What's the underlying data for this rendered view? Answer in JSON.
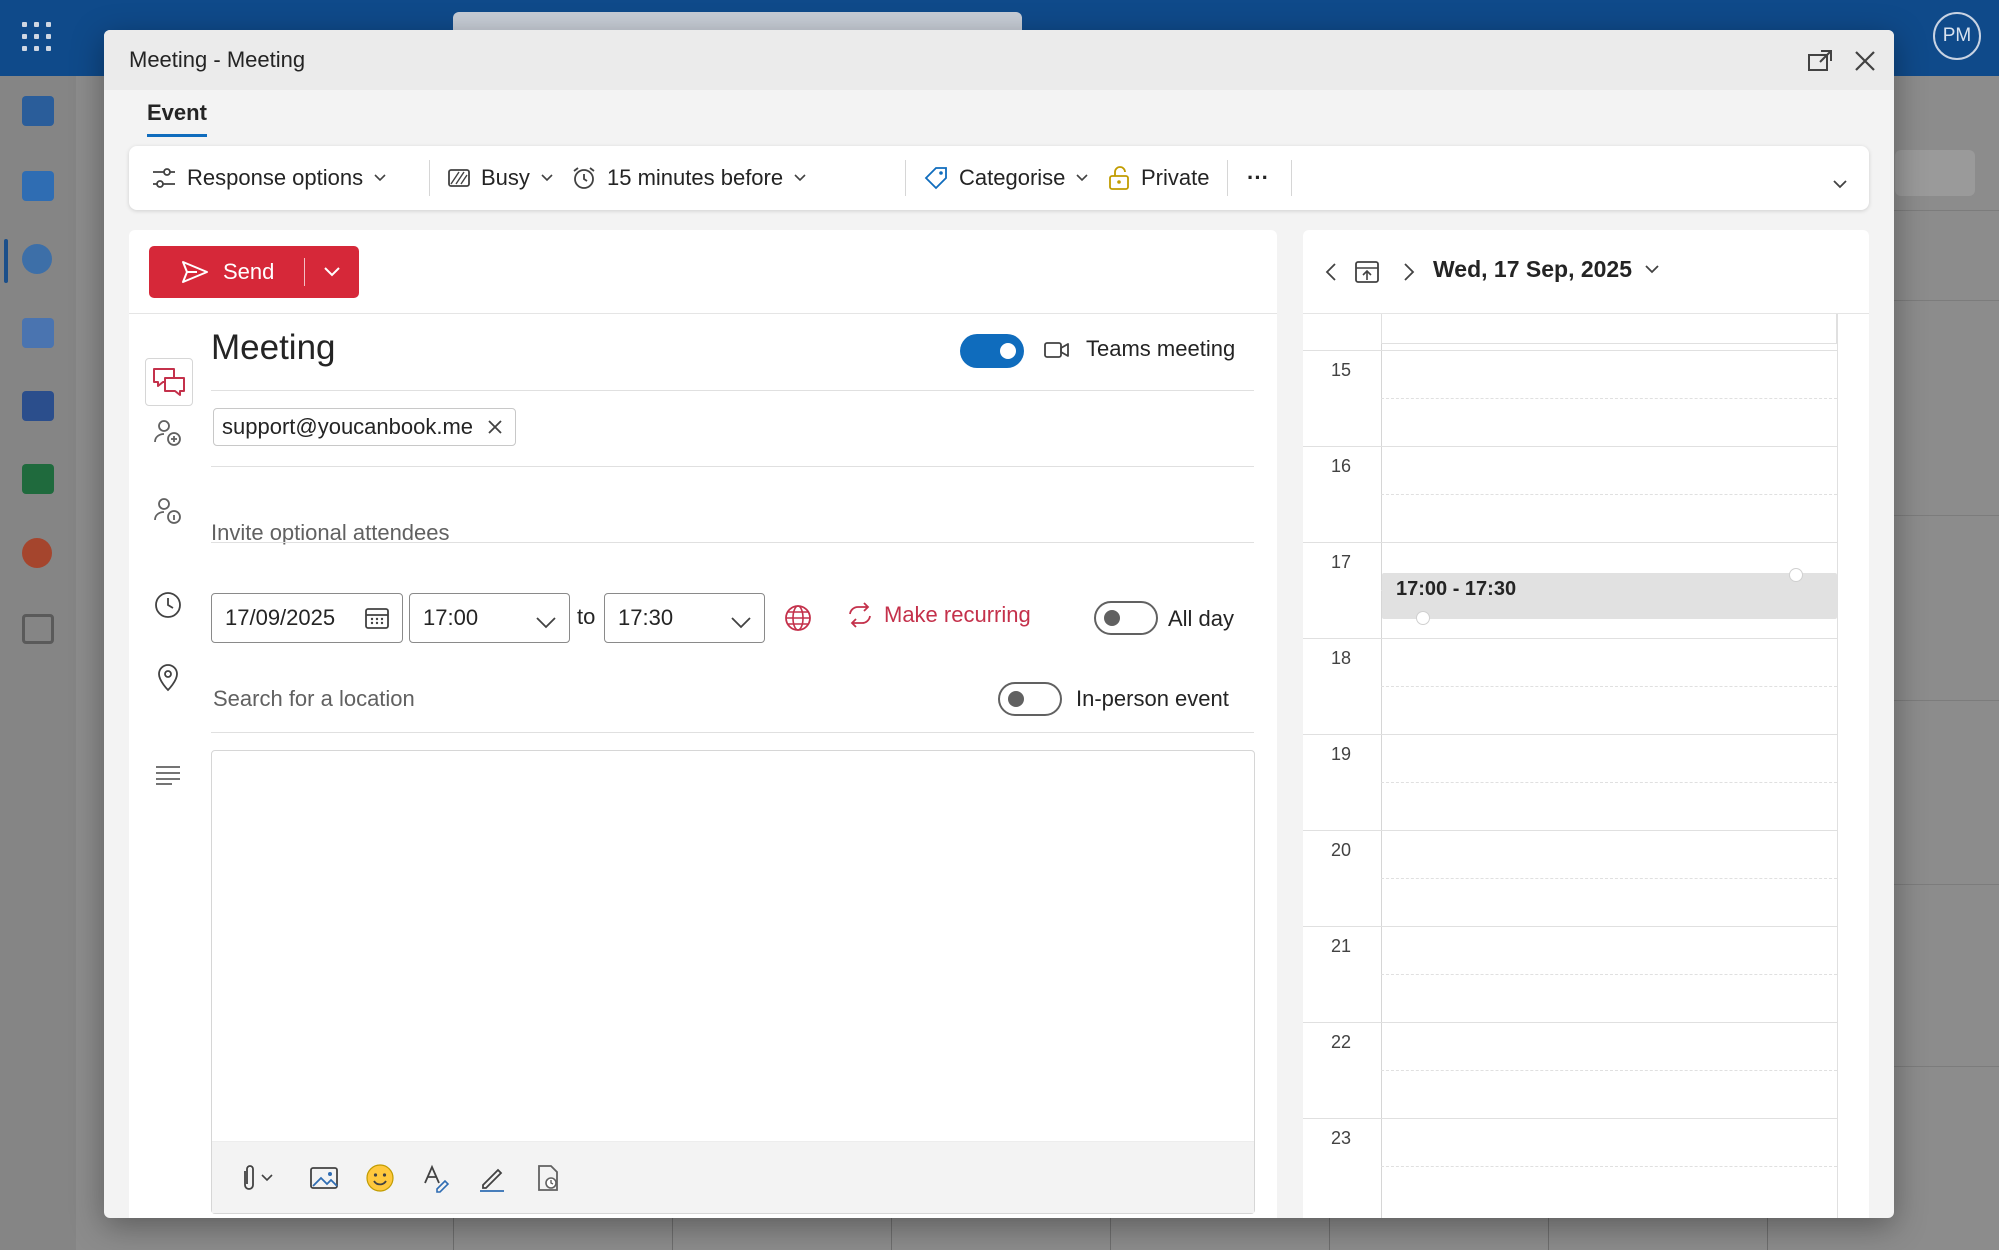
{
  "background": {
    "avatar_initials": "PM"
  },
  "dialog": {
    "title": "Meeting - Meeting",
    "tab": "Event"
  },
  "ribbon": {
    "response_options": "Response options",
    "busy": "Busy",
    "reminder": "15 minutes before",
    "categorise": "Categorise",
    "private": "Private",
    "more": "···"
  },
  "form": {
    "send_label": "Send",
    "title": "Meeting",
    "teams_label": "Teams meeting",
    "teams_on": true,
    "attendee": "support@youcanbook.me",
    "optional_placeholder": "Invite optional attendees",
    "date": "17/09/2025",
    "start_time": "17:00",
    "to_label": "to",
    "end_time": "17:30",
    "make_recurring": "Make recurring",
    "all_day_label": "All day",
    "all_day_on": false,
    "location_placeholder": "Search for a location",
    "in_person_label": "In-person event",
    "in_person_on": false
  },
  "calendar": {
    "date_label": "Wed, 17 Sep, 2025",
    "hours": [
      "15",
      "16",
      "17",
      "18",
      "19",
      "20",
      "21",
      "22",
      "23"
    ],
    "event_label": "17:00 - 17:30"
  },
  "colors": {
    "accent": "#0f6cbd",
    "send": "#d62839",
    "recurring": "#c4314b"
  }
}
